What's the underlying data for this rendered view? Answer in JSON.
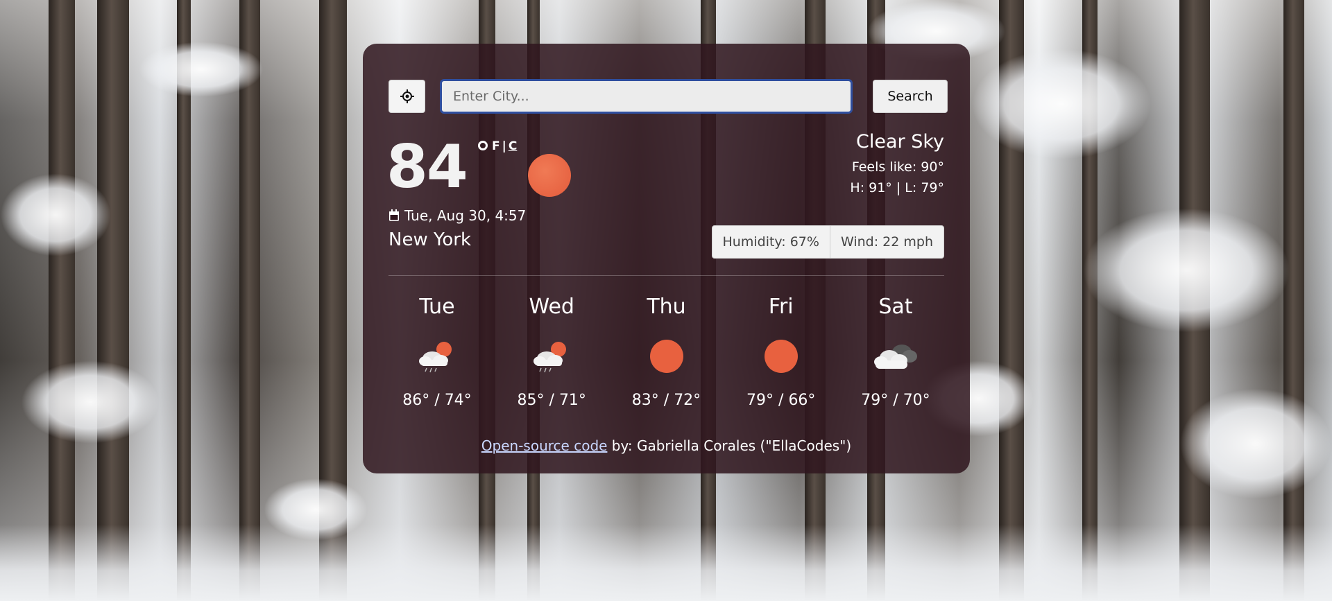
{
  "search": {
    "placeholder": "Enter City...",
    "value": "",
    "button_label": "Search",
    "location_icon": "crosshair-icon"
  },
  "current": {
    "temperature": "84",
    "unit_f": "F",
    "unit_separator": "|",
    "unit_c": "C",
    "icon": "sun-icon",
    "date": "Tue, Aug 30, 4:57",
    "city": "New York",
    "condition": "Clear Sky",
    "feels_like": "Feels like: 90°",
    "high_low": "H: 91° | L: 79°",
    "humidity": "Humidity: 67%",
    "wind": "Wind: 22 mph"
  },
  "forecast": [
    {
      "day": "Tue",
      "temps": "86° / 74°",
      "icon": "sun-cloud-rain-icon"
    },
    {
      "day": "Wed",
      "temps": "85° / 71°",
      "icon": "sun-cloud-rain-icon"
    },
    {
      "day": "Thu",
      "temps": "83° / 72°",
      "icon": "sun-icon"
    },
    {
      "day": "Fri",
      "temps": "79° / 66°",
      "icon": "sun-icon"
    },
    {
      "day": "Sat",
      "temps": "79° / 70°",
      "icon": "clouds-icon"
    }
  ],
  "footer": {
    "link_text": "Open-source code",
    "credit_text": " by: Gabriella Corales (\"EllaCodes\")"
  },
  "colors": {
    "card_bg": "#30161e",
    "sun": "#e8613f",
    "input_border": "#2f4f9f",
    "link": "#c9d7ff"
  }
}
